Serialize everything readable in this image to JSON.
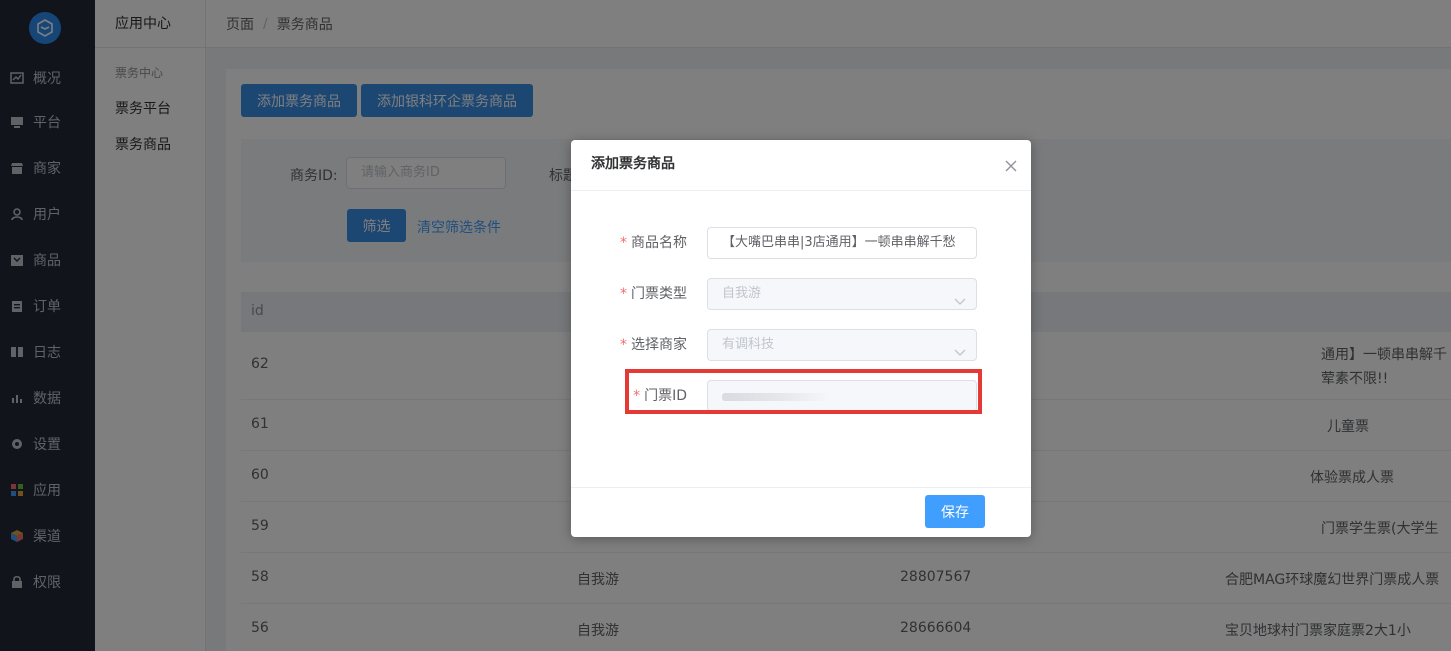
{
  "nav": {
    "items": [
      {
        "label": "概况",
        "icon": "chart-icon"
      },
      {
        "label": "平台",
        "icon": "monitor-icon"
      },
      {
        "label": "商家",
        "icon": "store-icon"
      },
      {
        "label": "用户",
        "icon": "user-icon"
      },
      {
        "label": "商品",
        "icon": "goods-icon"
      },
      {
        "label": "订单",
        "icon": "clipboard-icon"
      },
      {
        "label": "日志",
        "icon": "book-icon"
      },
      {
        "label": "数据",
        "icon": "bar-chart-icon"
      },
      {
        "label": "设置",
        "icon": "gear-icon"
      },
      {
        "label": "应用",
        "icon": "apps-grid-icon"
      },
      {
        "label": "渠道",
        "icon": "cube-icon"
      },
      {
        "label": "权限",
        "icon": "lock-icon"
      }
    ]
  },
  "sub_sidebar": {
    "title": "应用中心",
    "group": "票务中心",
    "items": [
      "票务平台",
      "票务商品"
    ]
  },
  "breadcrumb": {
    "root": "页面",
    "separator": "/",
    "current": "票务商品"
  },
  "toolbar": {
    "add_button": "添加票务商品",
    "add_yinke_button": "添加银科环企票务商品"
  },
  "filter": {
    "business_id_label": "商务ID:",
    "business_id_placeholder": "请输入商务ID",
    "title_label": "标题",
    "filter_button": "筛选",
    "clear_link": "清空筛选条件"
  },
  "table": {
    "header_id": "id",
    "rows": [
      {
        "id": "62",
        "type": "",
        "ticket_id": "",
        "name_line1": "通用】一顿串串解千",
        "name_line2": "荤素不限!!"
      },
      {
        "id": "61",
        "type": "",
        "ticket_id": "",
        "name_line1": "儿童票",
        "name_line2": ""
      },
      {
        "id": "60",
        "type": "",
        "ticket_id": "",
        "name_line1": "体验票成人票",
        "name_line2": ""
      },
      {
        "id": "59",
        "type": "",
        "ticket_id": "",
        "name_line1": "门票学生票(大学生",
        "name_line2": ""
      },
      {
        "id": "58",
        "type": "自我游",
        "ticket_id": "28807567",
        "name_line1": "合肥MAG环球魔幻世界门票成人票",
        "name_line2": ""
      },
      {
        "id": "56",
        "type": "自我游",
        "ticket_id": "28666604",
        "name_line1": "宝贝地球村门票家庭票2大1小",
        "name_line2": ""
      }
    ]
  },
  "dialog": {
    "title": "添加票务商品",
    "fields": {
      "name_label": "商品名称",
      "name_value": "【大嘴巴串串|3店通用】一顿串串解千愁",
      "ticket_type_label": "门票类型",
      "ticket_type_value": "自我游",
      "merchant_label": "选择商家",
      "merchant_value": "有调科技",
      "ticket_id_label": "门票ID",
      "required_mark": "*"
    },
    "save_button": "保存"
  },
  "colors": {
    "primary": "#409eff",
    "nav_bg": "#232a36",
    "highlight": "#e53935",
    "required": "#f56c6c"
  }
}
